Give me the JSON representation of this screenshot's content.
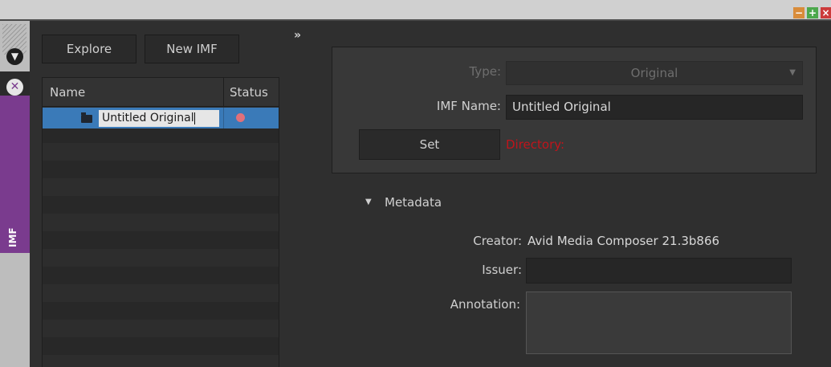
{
  "window": {
    "controls": {
      "minimize_icon": "−",
      "maximize_icon": "+",
      "close_icon": "×"
    }
  },
  "strip": {
    "collapse_icon": "▼",
    "close_icon": "✕",
    "tab_label": "IMF",
    "accent_color": "#7a3b8e"
  },
  "toolbar": {
    "explore_label": "Explore",
    "new_imf_label": "New IMF"
  },
  "bin": {
    "columns": {
      "name": "Name",
      "status": "Status"
    },
    "rows": [
      {
        "name": "Untitled Original",
        "status_color": "#e0707a",
        "icon": "folder-icon"
      }
    ]
  },
  "panel": {
    "collapse_arrows": "»"
  },
  "form": {
    "type_label": "Type:",
    "type_value": "Original",
    "imf_name_label": "IMF Name:",
    "imf_name_value": "Untitled Original",
    "set_label": "Set",
    "directory_label": "Directory:"
  },
  "metadata": {
    "title": "Metadata",
    "toggle_icon": "▼",
    "creator_label": "Creator:",
    "creator_value": "Avid Media Composer 21.3b866",
    "issuer_label": "Issuer:",
    "issuer_value": "",
    "annotation_label": "Annotation:",
    "annotation_value": ""
  }
}
